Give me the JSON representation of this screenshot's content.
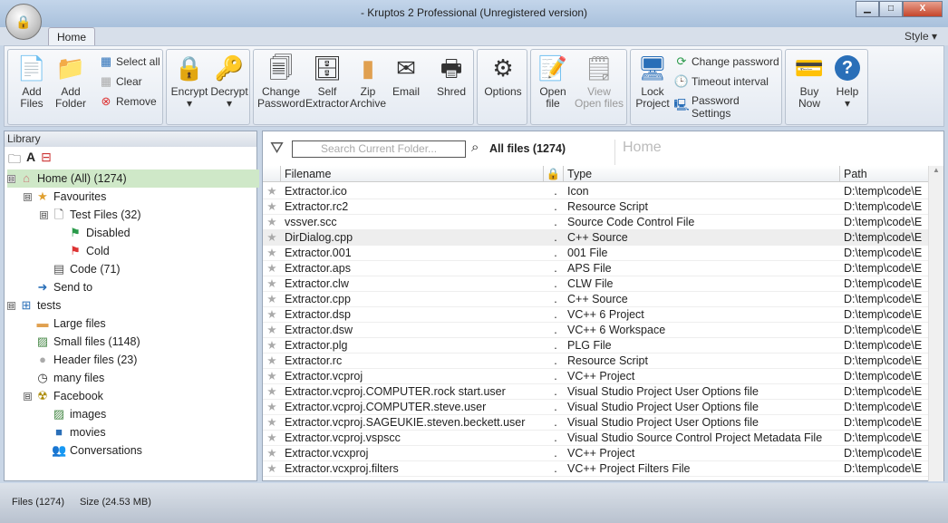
{
  "window": {
    "title": "- Kruptos 2 Professional (Unregistered version)",
    "minimize": "▁",
    "maximize": "□",
    "close": "X"
  },
  "ribbon": {
    "tab": "Home",
    "style": "Style ▾",
    "groups": {
      "files": {
        "add_files": "Add Files",
        "add_folder": "Add Folder",
        "select_all": "Select all",
        "clear": "Clear",
        "remove": "Remove"
      },
      "crypt": {
        "encrypt": "Encrypt",
        "decrypt": "Decrypt"
      },
      "tools": {
        "change_password": "Change Password",
        "self_extractor": "Self Extractor",
        "zip_archive": "Zip Archive",
        "email": "Email",
        "shred": "Shred"
      },
      "options": {
        "options": "Options"
      },
      "open": {
        "open_file": "Open file",
        "view_open_files": "View Open files"
      },
      "project": {
        "lock_project": "Lock Project",
        "change_password": "Change password",
        "timeout_interval": "Timeout interval",
        "password_settings": "Password Settings"
      },
      "help": {
        "buy_now": "Buy Now",
        "help": "Help"
      }
    }
  },
  "library": {
    "header": "Library",
    "tree": [
      {
        "label": "Home (All) (1274)",
        "icon": "home-icon",
        "level": 0,
        "expander": "⊟",
        "selected": true
      },
      {
        "label": "Favourites",
        "icon": "star-icon",
        "level": 1,
        "expander": "⊟"
      },
      {
        "label": "Test Files (32)",
        "icon": "file-icon",
        "level": 2,
        "expander": "⊟"
      },
      {
        "label": "Disabled",
        "icon": "green-flag-icon",
        "level": 3
      },
      {
        "label": "Cold",
        "icon": "red-flag-icon",
        "level": 3
      },
      {
        "label": "Code (71)",
        "icon": "code-list-icon",
        "level": 2
      },
      {
        "label": "Send to",
        "icon": "arrow-right-icon",
        "level": 1
      },
      {
        "label": "tests",
        "icon": "add-group-icon",
        "level": 0,
        "expander": "⊟"
      },
      {
        "label": "Large files",
        "icon": "folder-icon",
        "level": 1
      },
      {
        "label": "Small files (1148)",
        "icon": "image-icon",
        "level": 1
      },
      {
        "label": "Header files (23)",
        "icon": "circle-icon",
        "level": 1
      },
      {
        "label": "many files",
        "icon": "clock-icon",
        "level": 1
      },
      {
        "label": "Facebook",
        "icon": "radiation-icon",
        "level": 1,
        "expander": "⊟"
      },
      {
        "label": "images",
        "icon": "image-icon",
        "level": 2
      },
      {
        "label": "movies",
        "icon": "video-icon",
        "level": 2
      },
      {
        "label": "Conversations",
        "icon": "users-icon",
        "level": 2
      }
    ]
  },
  "files": {
    "search_placeholder": "Search Current Folder...",
    "count_label": "All files (1274)",
    "breadcrumb": "Home",
    "columns": [
      "Filename",
      "Type",
      "Path"
    ],
    "rows": [
      [
        "Extractor.ico",
        "Icon",
        "D:\\temp\\code\\E"
      ],
      [
        "Extractor.rc2",
        "Resource Script",
        "D:\\temp\\code\\E"
      ],
      [
        "vssver.scc",
        "Source Code Control File",
        "D:\\temp\\code\\E"
      ],
      [
        "DirDialog.cpp",
        "C++ Source",
        "D:\\temp\\code\\E"
      ],
      [
        "Extractor.001",
        "001 File",
        "D:\\temp\\code\\E"
      ],
      [
        "Extractor.aps",
        "APS File",
        "D:\\temp\\code\\E"
      ],
      [
        "Extractor.clw",
        "CLW File",
        "D:\\temp\\code\\E"
      ],
      [
        "Extractor.cpp",
        "C++ Source",
        "D:\\temp\\code\\E"
      ],
      [
        "Extractor.dsp",
        "VC++ 6 Project",
        "D:\\temp\\code\\E"
      ],
      [
        "Extractor.dsw",
        "VC++ 6 Workspace",
        "D:\\temp\\code\\E"
      ],
      [
        "Extractor.plg",
        "PLG File",
        "D:\\temp\\code\\E"
      ],
      [
        "Extractor.rc",
        "Resource Script",
        "D:\\temp\\code\\E"
      ],
      [
        "Extractor.vcproj",
        "VC++ Project",
        "D:\\temp\\code\\E"
      ],
      [
        "Extractor.vcproj.COMPUTER.rock start.user",
        "Visual Studio Project User Options file",
        "D:\\temp\\code\\E"
      ],
      [
        "Extractor.vcproj.COMPUTER.steve.user",
        "Visual Studio Project User Options file",
        "D:\\temp\\code\\E"
      ],
      [
        "Extractor.vcproj.SAGEUKIE.steven.beckett.user",
        "Visual Studio Project User Options file",
        "D:\\temp\\code\\E"
      ],
      [
        "Extractor.vcproj.vspscc",
        "Visual Studio Source Control Project Metadata File",
        "D:\\temp\\code\\E"
      ],
      [
        "Extractor.vcxproj",
        "VC++ Project",
        "D:\\temp\\code\\E"
      ],
      [
        "Extractor.vcxproj.filters",
        "VC++ Project Filters File",
        "D:\\temp\\code\\E"
      ]
    ],
    "highlighted_row": 3
  },
  "status": {
    "files": "Files (1274)",
    "size": "Size (24.53 MB)"
  }
}
